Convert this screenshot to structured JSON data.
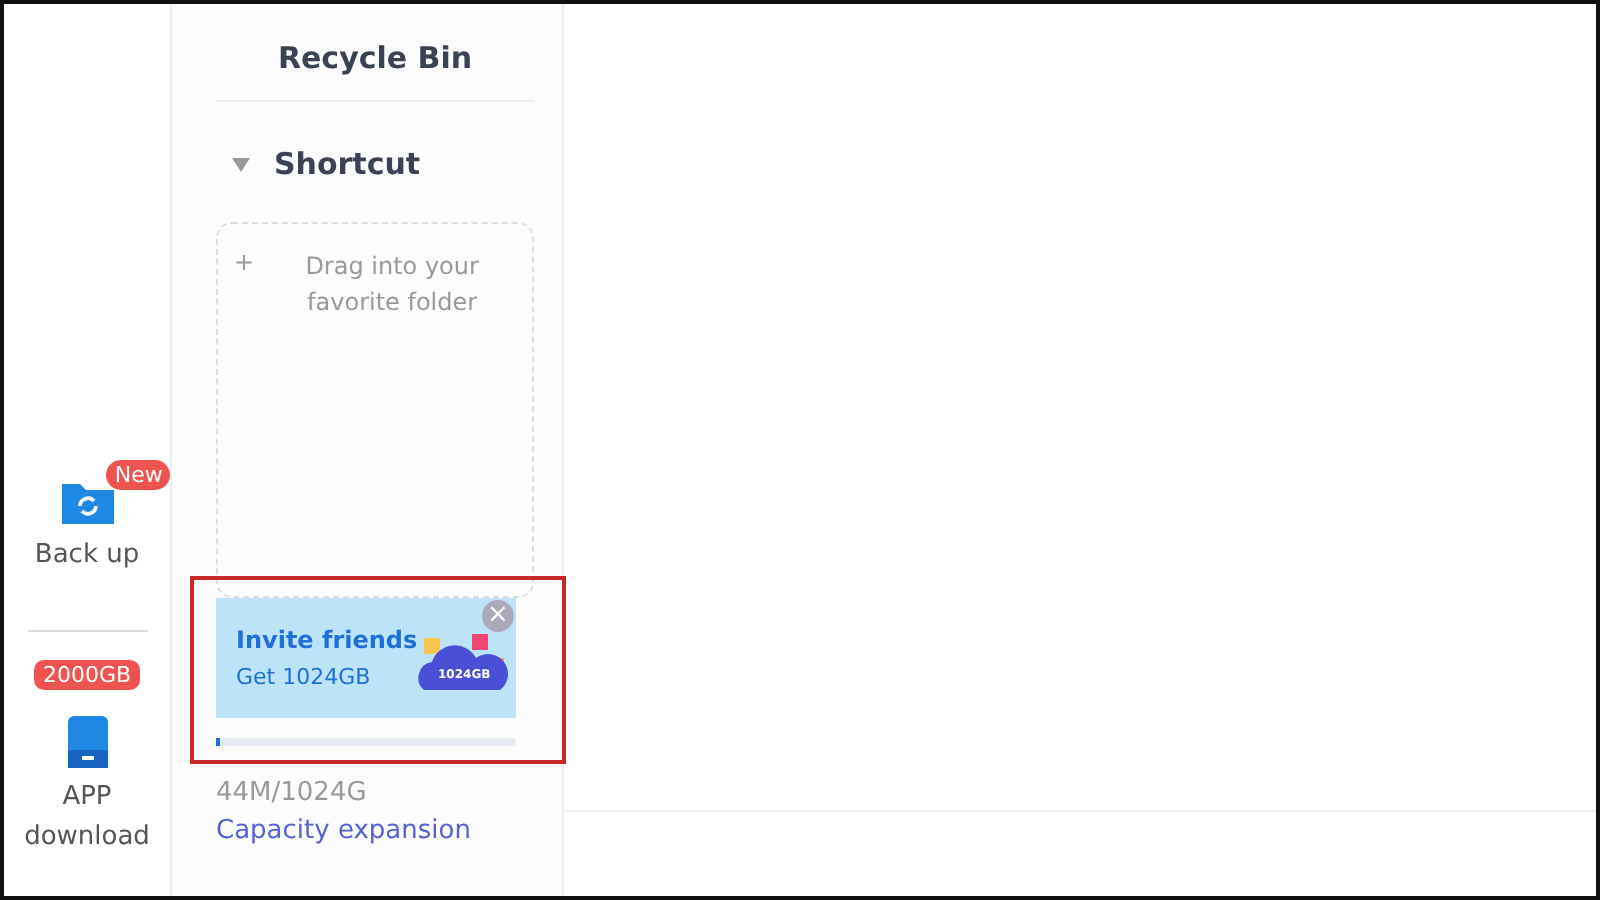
{
  "rail": [
    {
      "kind": "backup",
      "label": "Back up",
      "badge": "New"
    },
    {
      "kind": "app",
      "label": "APP download",
      "badge": "2000GB"
    }
  ],
  "sidebar": {
    "recycle_bin": "Recycle Bin",
    "shortcut": {
      "title": "Shortcut",
      "expanded": true,
      "plus": "+",
      "hint": "Drag into your favorite folder"
    },
    "banner": {
      "title": "Invite friends",
      "subtitle": "Get 1024GB",
      "cloud_label": "1024GB",
      "close": "×"
    },
    "storage": {
      "usage": "44M/1024G",
      "level": 0.0,
      "link": "Capacity expansion"
    }
  }
}
